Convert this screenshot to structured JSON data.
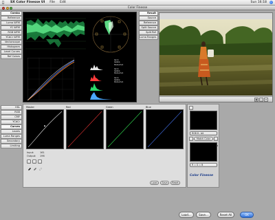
{
  "menubar": {
    "apple": "",
    "app_name": "SX Color Finesse UI",
    "items": [
      "File",
      "Edit"
    ],
    "clock": "Sun 16:18"
  },
  "window": {
    "title": "Color Finesse"
  },
  "scope_tabs": [
    "Combo",
    "Reference",
    "Luma WFM",
    "YC WFM",
    "RGB WFM",
    "YCbCr WFM",
    "Vectorscope",
    "Histogram",
    "Level Curves",
    "Ref Colors"
  ],
  "correction_tabs": [
    "HSL",
    "RGB",
    "CMY",
    "YCbCr",
    "Curves",
    "Levels",
    "Luma Ranges",
    "Secondary",
    "Limiting"
  ],
  "preview_tabs": [
    "Result",
    "Source",
    "Reference",
    "Split Source",
    "Split Ref",
    "Luma Ranges"
  ],
  "gain_table": [
    "Gain",
    "Gamma",
    "Pedestal",
    "Gain",
    "Gamma",
    "Pedestal",
    "Gain",
    "Gamma",
    "Pedestal"
  ],
  "curves": {
    "channels": [
      "Master",
      "Red",
      "Green",
      "Blue"
    ],
    "input_label": "Input:",
    "input_value": "161",
    "output_label": "Output:",
    "output_value": "196",
    "load_label": "Load",
    "save_label": "Save",
    "reset_label": "Reset"
  },
  "color_panel": {
    "rgb_select": "RGB 8 - bit",
    "match_button": "Match Color",
    "source_select": "R = G = B",
    "brand": "Color Finesse"
  },
  "bottom_buttons": {
    "load": "Load...",
    "save": "Save...",
    "reset_all": "Reset All",
    "ok": "OK"
  },
  "colors": {
    "accent": "#2f6fd6",
    "scope_green": "#2bd86a",
    "curve_master": "#e8e8e8",
    "curve_red": "#ff3b3b",
    "curve_green": "#3bff5e",
    "curve_blue": "#4a7bff"
  }
}
